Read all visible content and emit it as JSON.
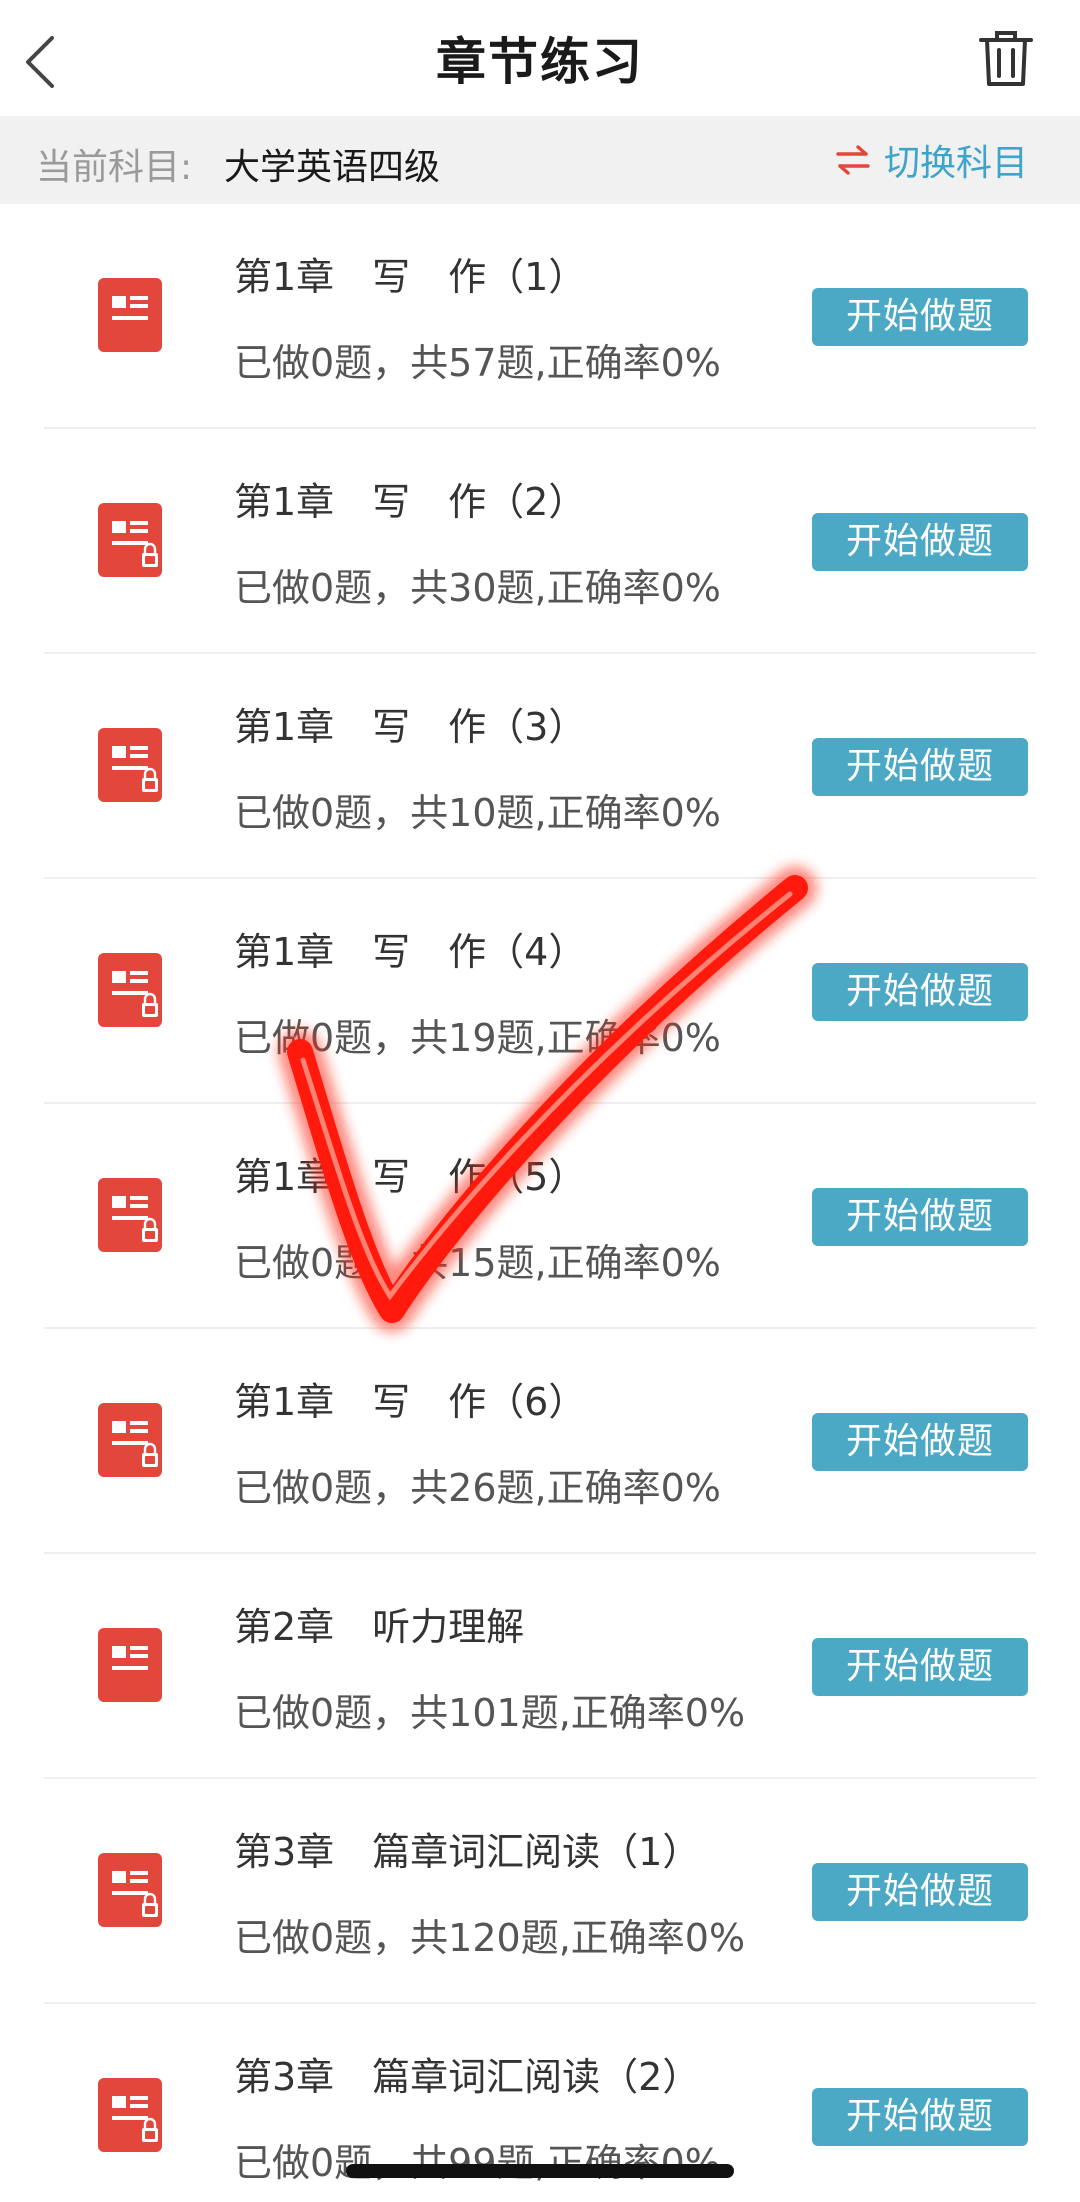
{
  "header": {
    "title": "章节练习",
    "back_icon": "chevron-left-icon",
    "trash_icon": "trash-icon"
  },
  "subject_bar": {
    "label": "当前科目:",
    "value": "大学英语四级",
    "switch_label": "切换科目",
    "switch_icon": "swap-arrows-icon"
  },
  "colors": {
    "accent_button": "#4ba9c6",
    "switch_text": "#3fa4c9",
    "switch_icon": "#e3463a",
    "chapter_icon": "#e3463a",
    "check_mark": "#ff1a0d"
  },
  "chapters": [
    {
      "title": "第1章　写　作（1）",
      "stats": "已做0题，共57题,正确率0%",
      "button": "开始做题",
      "locked": false
    },
    {
      "title": "第1章　写　作（2）",
      "stats": "已做0题，共30题,正确率0%",
      "button": "开始做题",
      "locked": true
    },
    {
      "title": "第1章　写　作（3）",
      "stats": "已做0题，共10题,正确率0%",
      "button": "开始做题",
      "locked": true
    },
    {
      "title": "第1章　写　作（4）",
      "stats": "已做0题，共19题,正确率0%",
      "button": "开始做题",
      "locked": true
    },
    {
      "title": "第1章　写　作（5）",
      "stats": "已做0题，共15题,正确率0%",
      "button": "开始做题",
      "locked": true
    },
    {
      "title": "第1章　写　作（6）",
      "stats": "已做0题，共26题,正确率0%",
      "button": "开始做题",
      "locked": true
    },
    {
      "title": "第2章　听力理解",
      "stats": "已做0题，共101题,正确率0%",
      "button": "开始做题",
      "locked": false
    },
    {
      "title": "第3章　篇章词汇阅读（1）",
      "stats": "已做0题，共120题,正确率0%",
      "button": "开始做题",
      "locked": true
    },
    {
      "title": "第3章　篇章词汇阅读（2）",
      "stats": "已做0题，共99题,正确率0%",
      "button": "开始做题",
      "locked": true
    }
  ]
}
